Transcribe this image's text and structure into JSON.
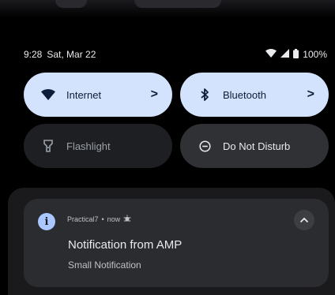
{
  "status_bar": {
    "time": "9:28",
    "date": "Sat, Mar 22",
    "battery": "100%",
    "icons": [
      "wifi-icon",
      "cellular-signal-icon",
      "battery-icon"
    ]
  },
  "quick_settings": {
    "tiles": [
      {
        "name": "internet",
        "label": "Internet",
        "state": "on",
        "icon": "wifi-icon",
        "chevron": ">"
      },
      {
        "name": "bluetooth",
        "label": "Bluetooth",
        "state": "on",
        "icon": "bluetooth-icon",
        "chevron": ">"
      },
      {
        "name": "flashlight",
        "label": "Flashlight",
        "state": "off",
        "icon": "flashlight-icon"
      },
      {
        "name": "do-not-disturb",
        "label": "Do Not Disturb",
        "state": "off",
        "icon": "do-not-disturb-icon"
      }
    ]
  },
  "notification": {
    "app_name": "Practical7",
    "separator": "•",
    "time": "now",
    "title": "Notification from AMP",
    "text": "Small Notification",
    "icon": "info-icon"
  },
  "colors": {
    "background": "#000000",
    "tile_on": "#d3e3fd",
    "tile_off": "#1e1f23",
    "card": "#2b2c30",
    "accent": "#aac7ff"
  }
}
